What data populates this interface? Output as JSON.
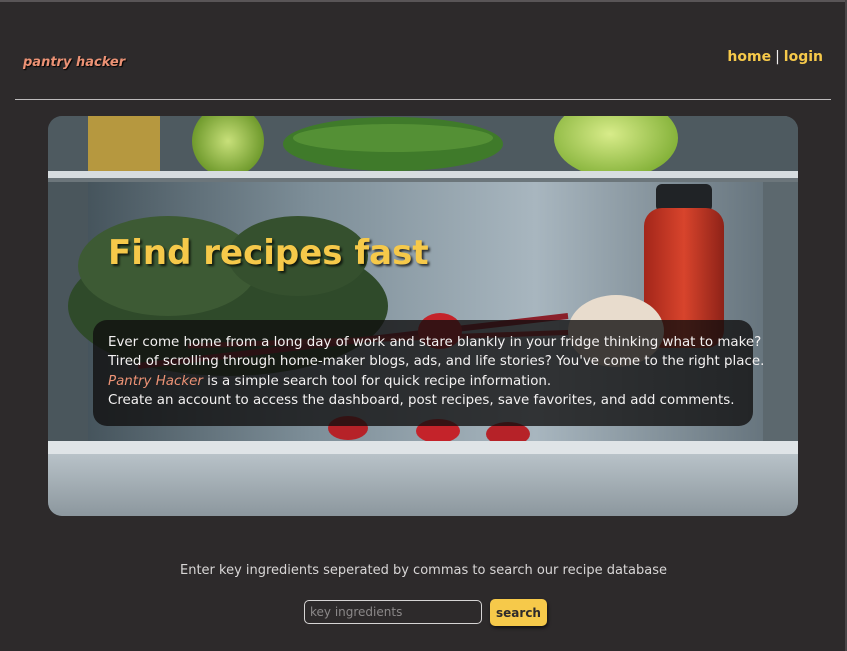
{
  "header": {
    "brand": "pantry hacker",
    "nav": [
      {
        "label": "home"
      },
      {
        "label": "login"
      }
    ],
    "nav_separator": "|"
  },
  "hero": {
    "title": "Find recipes fast",
    "lines": [
      "Ever come home from a long day of work and stare blankly in your fridge thinking what to make?",
      "Tired of scrolling through home-maker blogs, ads, and life stories? You've come to the right place."
    ],
    "brand_mention": "Pantry Hacker",
    "brand_line_rest": " is a simple search tool for quick recipe information.",
    "last_line": "Create an account to access the dashboard, post recipes, save favorites, and add comments."
  },
  "search": {
    "prompt": "Enter key ingredients seperated by commas to search our recipe database",
    "placeholder": "key ingredients",
    "button_label": "search"
  },
  "colors": {
    "background": "#2d2a2b",
    "accent_yellow": "#f6c94a",
    "accent_salmon": "#ec9275"
  },
  "icons": []
}
